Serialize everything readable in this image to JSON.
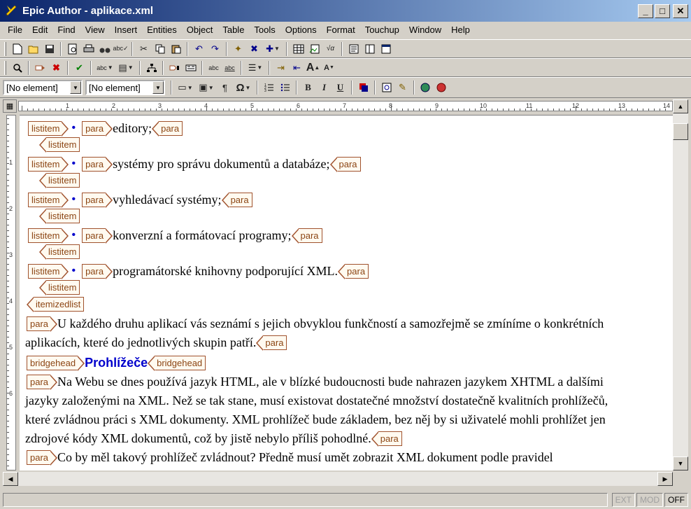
{
  "window": {
    "title": "Epic Author - aplikace.xml",
    "min_label": "_",
    "max_label": "□",
    "close_label": "✕"
  },
  "menu": [
    "File",
    "Edit",
    "Find",
    "View",
    "Insert",
    "Entities",
    "Object",
    "Table",
    "Tools",
    "Options",
    "Format",
    "Touchup",
    "Window",
    "Help"
  ],
  "toolbar": {
    "element_combo_1": "[No element]",
    "element_combo_2": "[No element]",
    "pilcrow": "¶",
    "omega": "Ω",
    "bold": "B",
    "italic": "I",
    "underline": "U"
  },
  "ruler": {
    "numbers": [
      "1",
      "2",
      "3",
      "4",
      "5",
      "6",
      "7",
      "8",
      "9",
      "10",
      "11",
      "12",
      "13",
      "14"
    ],
    "vnumbers": [
      "1",
      "2",
      "3",
      "4",
      "5",
      "6"
    ]
  },
  "document": {
    "list_items": [
      "editory;",
      "systémy pro správu dokumentů a databáze;",
      "vyhledávací systémy;",
      "konverzní a formátovací programy;",
      "programátorské knihovny podporující XML."
    ],
    "bullet": "•",
    "tags": {
      "listitem": "listitem",
      "para": "para",
      "itemizedlist": "itemizedlist",
      "bridgehead": "bridgehead"
    },
    "para1": [
      "U každého druhu aplikací vás seznámí s jejich obvyklou funkčností a samozřejmě se zmíníme o konkrétních",
      "aplikacích, které do jednotlivých skupin patří."
    ],
    "bridgehead": "Prohlížeče",
    "para2": [
      "Na Webu se dnes používá jazyk HTML, ale v blízké budoucnosti bude nahrazen jazykem XHTML a dalšími",
      "jazyky založenými na XML. Než se tak stane, musí existovat dostatečné množství dostatečně kvalitních prohlížečů,",
      "které zvládnou práci s XML dokumenty. XML prohlížeč bude základem, bez něj by si uživatelé mohli prohlížet jen",
      "zdrojové kódy XML dokumentů, což by jistě nebylo příliš pohodlné."
    ],
    "para3": "Co by měl takový prohlížeč zvládnout? Předně musí umět zobrazit XML dokument podle pravidel"
  },
  "status": {
    "ext": "EXT",
    "mod": "MOD",
    "off": "OFF"
  }
}
